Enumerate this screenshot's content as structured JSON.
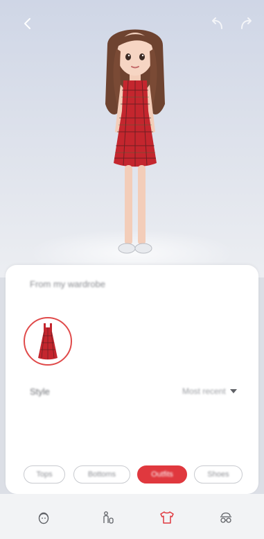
{
  "header": {
    "back_icon": "chevron-left-icon",
    "undo_icon": "undo-icon",
    "redo_icon": "redo-icon"
  },
  "wardrobe": {
    "section_title": "From my wardrobe",
    "items": [
      {
        "name": "Red plaid dress",
        "icon": "dress-icon",
        "selected": true
      }
    ]
  },
  "style": {
    "label": "Style",
    "value": "Most recent"
  },
  "tabs": [
    {
      "label": "Tops"
    },
    {
      "label": "Bottoms"
    },
    {
      "label": "Outfits"
    },
    {
      "label": "Shoes"
    }
  ],
  "bottom_nav": [
    {
      "icon": "face-icon"
    },
    {
      "icon": "body-icon"
    },
    {
      "icon": "tshirt-icon"
    },
    {
      "icon": "glasses-icon"
    }
  ],
  "colors": {
    "accent": "#e0383e",
    "dress": "#c4262e",
    "icon": "#5f6166"
  }
}
